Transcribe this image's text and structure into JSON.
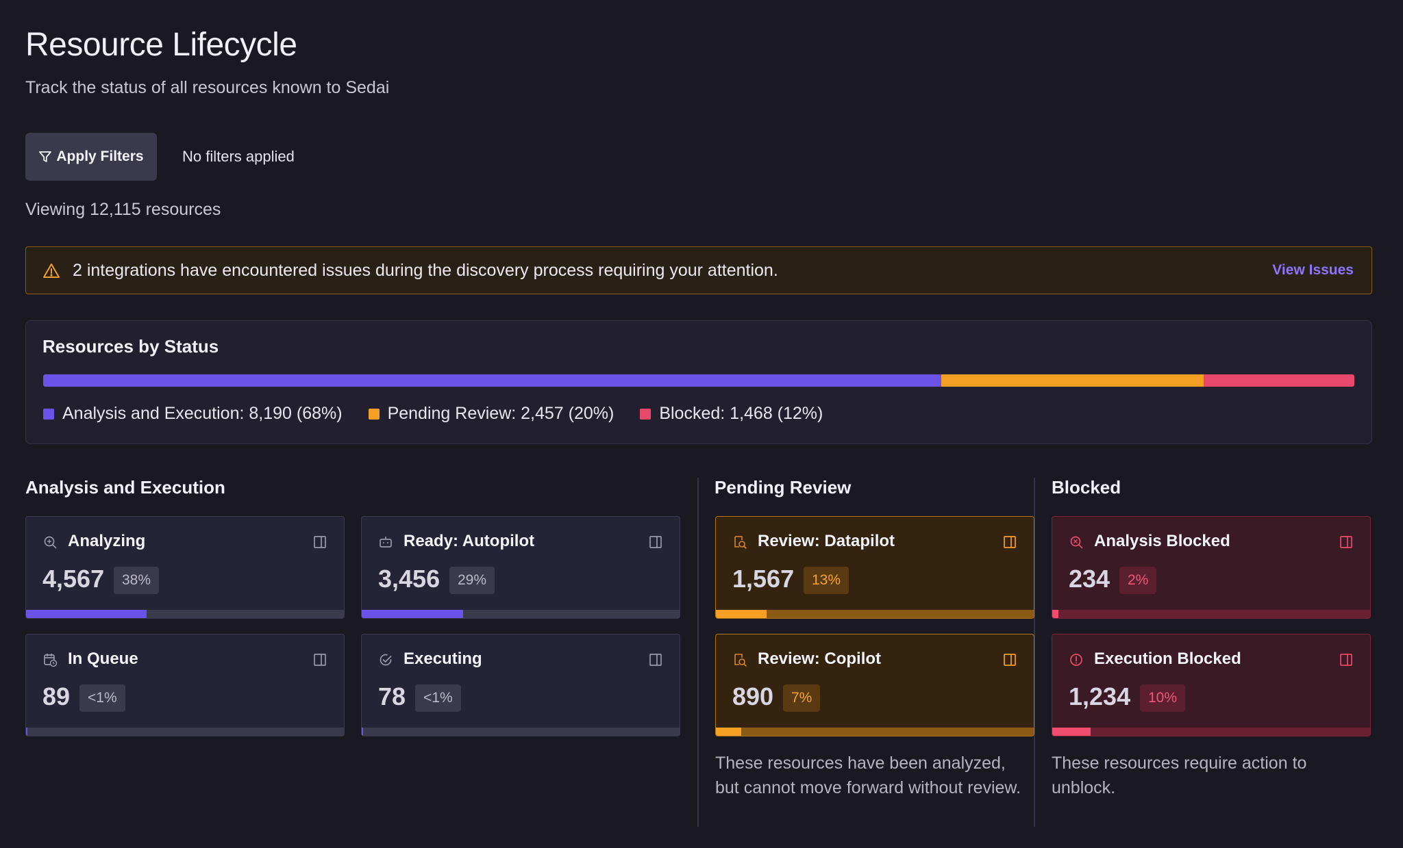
{
  "header": {
    "title": "Resource Lifecycle",
    "subtitle": "Track the status of all resources known to Sedai"
  },
  "filters": {
    "button_label": "Apply Filters",
    "status": "No filters applied",
    "button_icon": "filter-icon"
  },
  "viewing": "Viewing 12,115 resources",
  "alert": {
    "icon": "warning-icon",
    "message": "2 integrations have encountered issues during the discovery process requiring your attention.",
    "link_label": "View Issues"
  },
  "status_panel": {
    "title": "Resources by Status",
    "segments": [
      {
        "label": "Analysis and Execution: 8,190 (68%)",
        "fraction": 0.685,
        "color": "#6b52e8"
      },
      {
        "label": "Pending Review: 2,457 (20%)",
        "fraction": 0.2,
        "color": "#f59f24"
      },
      {
        "label": "Blocked: 1,468 (12%)",
        "fraction": 0.115,
        "color": "#e8496b"
      }
    ]
  },
  "sections": {
    "analysis": {
      "title": "Analysis and Execution",
      "cards": [
        {
          "title": "Analyzing",
          "value": "4,567",
          "badge": "38%",
          "progress": 0.38,
          "icon": "analyze-search-icon"
        },
        {
          "title": "Ready: Autopilot",
          "value": "3,456",
          "badge": "29%",
          "progress": 0.32,
          "icon": "robot-icon"
        },
        {
          "title": "In Queue",
          "value": "89",
          "badge": "<1%",
          "progress": 0.005,
          "icon": "calendar-clock-icon"
        },
        {
          "title": "Executing",
          "value": "78",
          "badge": "<1%",
          "progress": 0.005,
          "icon": "check-circle-icon"
        }
      ]
    },
    "pending": {
      "title": "Pending Review",
      "cards": [
        {
          "title": "Review: Datapilot",
          "value": "1,567",
          "badge": "13%",
          "progress": 0.16,
          "icon": "review-icon"
        },
        {
          "title": "Review: Copilot",
          "value": "890",
          "badge": "7%",
          "progress": 0.08,
          "icon": "review-icon"
        }
      ],
      "note": "These resources have been analyzed, but cannot move forward without review."
    },
    "blocked": {
      "title": "Blocked",
      "cards": [
        {
          "title": "Analysis Blocked",
          "value": "234",
          "badge": "2%",
          "progress": 0.02,
          "icon": "search-blocked-icon"
        },
        {
          "title": "Execution Blocked",
          "value": "1,234",
          "badge": "10%",
          "progress": 0.12,
          "icon": "alert-circle-icon"
        }
      ],
      "note": "These resources require action to unblock."
    }
  }
}
